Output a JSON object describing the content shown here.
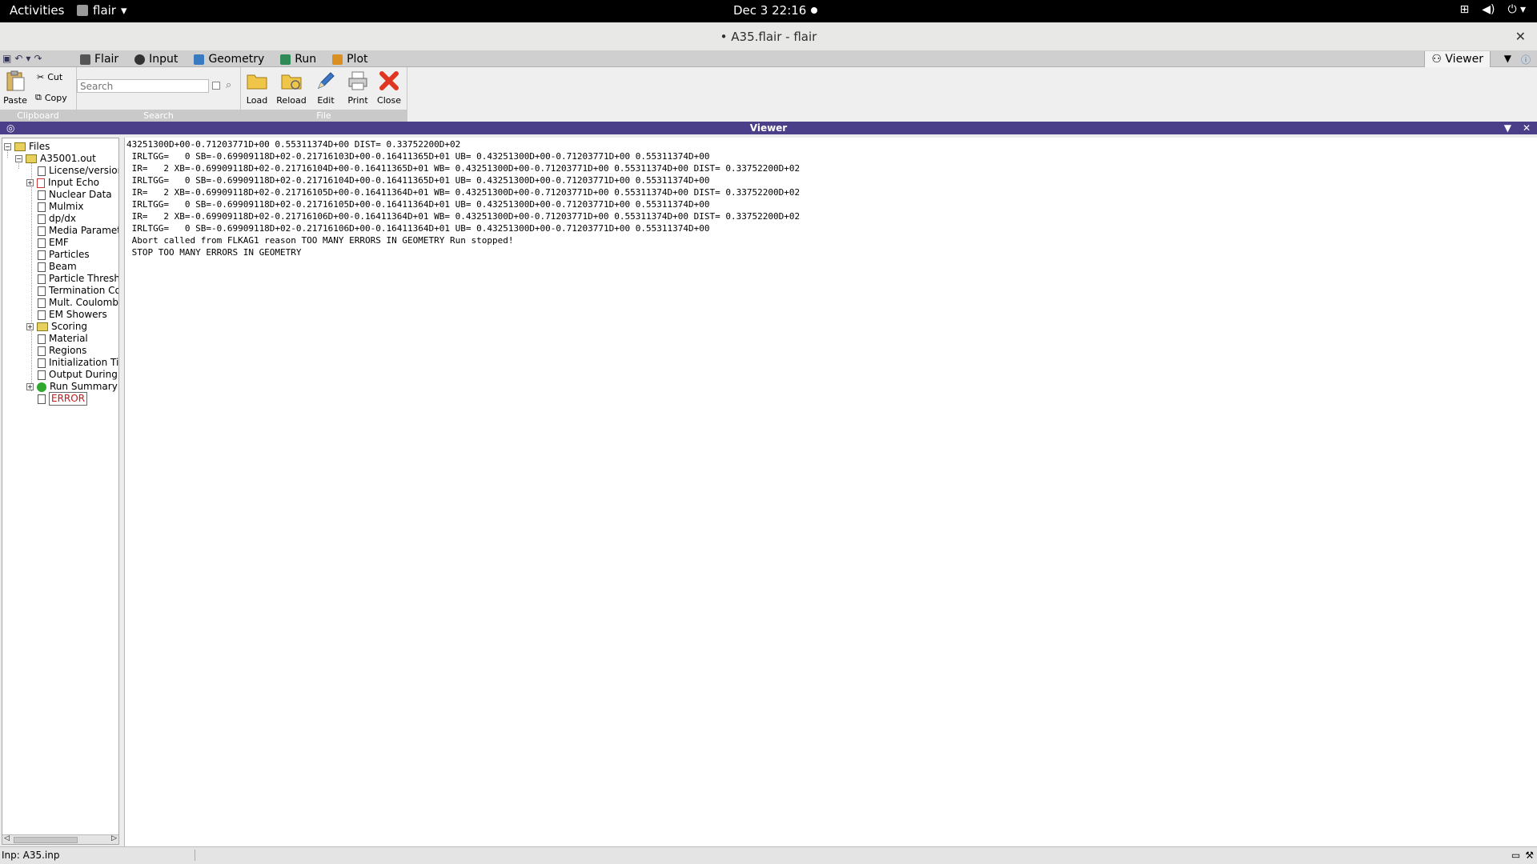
{
  "topbar": {
    "activities": "Activities",
    "app_name": "flair",
    "clock": "Dec 3  22:16",
    "tray_icons": [
      "network-icon",
      "volume-icon",
      "power-icon"
    ]
  },
  "window": {
    "title": "• A35.flair - flair",
    "close": "✕"
  },
  "ribbon_tabs": [
    {
      "label": "Flair",
      "icon": "flair-icon",
      "color": "#555555"
    },
    {
      "label": "Input",
      "icon": "input-icon",
      "color": "#333333"
    },
    {
      "label": "Geometry",
      "icon": "geometry-icon",
      "color": "#3a7ac0"
    },
    {
      "label": "Run",
      "icon": "run-icon",
      "color": "#2e8b57"
    },
    {
      "label": "Plot",
      "icon": "plot-icon",
      "color": "#d99020"
    }
  ],
  "viewer_tab": "Viewer",
  "clipboard": {
    "paste": "Paste",
    "cut": "Cut",
    "copy": "Copy",
    "group": "Clipboard"
  },
  "search": {
    "placeholder": "Search",
    "group": "Search"
  },
  "file_group": {
    "load": "Load",
    "reload": "Reload",
    "edit": "Edit",
    "print": "Print",
    "close": "Close",
    "group": "File"
  },
  "viewer_header": "Viewer",
  "tree": {
    "root": "Files",
    "file": "A35001.out",
    "items": [
      "License/version",
      "Input Echo",
      "Nuclear Data",
      "Mulmix",
      "dp/dx",
      "Media Parameters",
      "EMF",
      "Particles",
      "Beam",
      "Particle Thresholds",
      "Termination Conditions",
      "Mult. Coulomb",
      "EM Showers",
      "Scoring",
      "Material",
      "Regions",
      "Initialization Time",
      "Output During",
      "Run Summary",
      "ERROR"
    ]
  },
  "viewer_lines": [
    "43251300D+00-0.71203771D+00 0.55311374D+00 DIST= 0.33752200D+02",
    " IRLTGG=   0 SB=-0.69909118D+02-0.21716103D+00-0.16411365D+01 UB= 0.43251300D+00-0.71203771D+00 0.55311374D+00",
    " IR=   2 XB=-0.69909118D+02-0.21716104D+00-0.16411365D+01 WB= 0.43251300D+00-0.71203771D+00 0.55311374D+00 DIST= 0.33752200D+02",
    " IRLTGG=   0 SB=-0.69909118D+02-0.21716104D+00-0.16411365D+01 UB= 0.43251300D+00-0.71203771D+00 0.55311374D+00",
    " IR=   2 XB=-0.69909118D+02-0.21716105D+00-0.16411364D+01 WB= 0.43251300D+00-0.71203771D+00 0.55311374D+00 DIST= 0.33752200D+02",
    " IRLTGG=   0 SB=-0.69909118D+02-0.21716105D+00-0.16411364D+01 UB= 0.43251300D+00-0.71203771D+00 0.55311374D+00",
    " IR=   2 XB=-0.69909118D+02-0.21716106D+00-0.16411364D+01 WB= 0.43251300D+00-0.71203771D+00 0.55311374D+00 DIST= 0.33752200D+02",
    " IRLTGG=   0 SB=-0.69909118D+02-0.21716106D+00-0.16411364D+01 UB= 0.43251300D+00-0.71203771D+00 0.55311374D+00",
    " Abort called from FLKAG1 reason TOO MANY ERRORS IN GEOMETRY Run stopped!",
    " STOP TOO MANY ERRORS IN GEOMETRY"
  ],
  "status": {
    "message": "Inp: A35.inp"
  }
}
